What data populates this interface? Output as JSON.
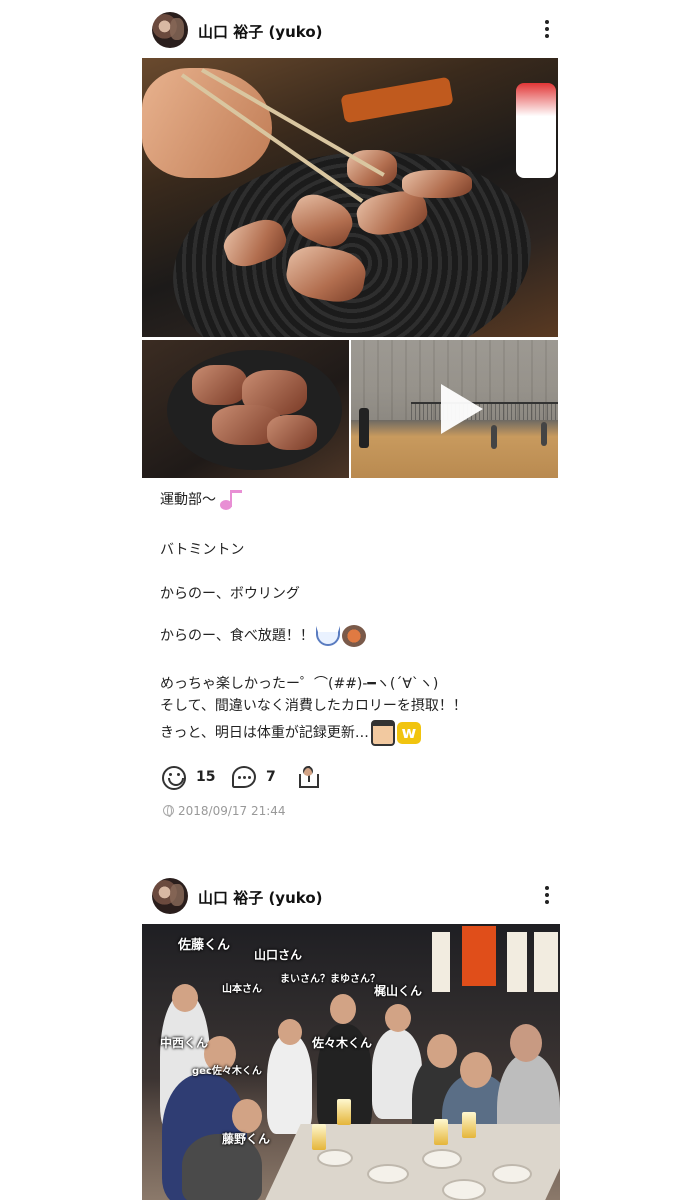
{
  "posts": [
    {
      "author": "山口 裕子 (yuko)",
      "caption": {
        "line1": "運動部〜",
        "line2": "バトミントン",
        "line3": "からのー、ボウリング",
        "line4": "からのー、食べ放題！！",
        "line5": "めっちゃ楽しかったー゜⌒(##)-━ヽ(´∀`ヽ)",
        "line6": "そして、間違いなく消費したカロリーを摂取！！",
        "line7": "きっと、明日は体重が記録更新…"
      },
      "emojis": [
        "music-note",
        "rice-bowl",
        "hot-pot",
        "man-face",
        "w-sign"
      ],
      "likes": "15",
      "comments": "7",
      "timestamp": "2018/09/17 21:44"
    },
    {
      "author": "山口 裕子 (yuko)",
      "photo_tags": {
        "sato": "佐藤くん",
        "yamaguchi": "山口さん",
        "maisan": "まいさん？まゆさん？",
        "yamamoto": "山本さん",
        "kajiyama": "梶山くん",
        "nakanishi": "中西くん",
        "sasaki": "佐々木くん",
        "gec_sasaki": "gec佐々木くん",
        "fujino": "藤野くん"
      }
    }
  ],
  "colors": {
    "text": "#222222",
    "muted": "#999999",
    "background": "#ffffff"
  }
}
